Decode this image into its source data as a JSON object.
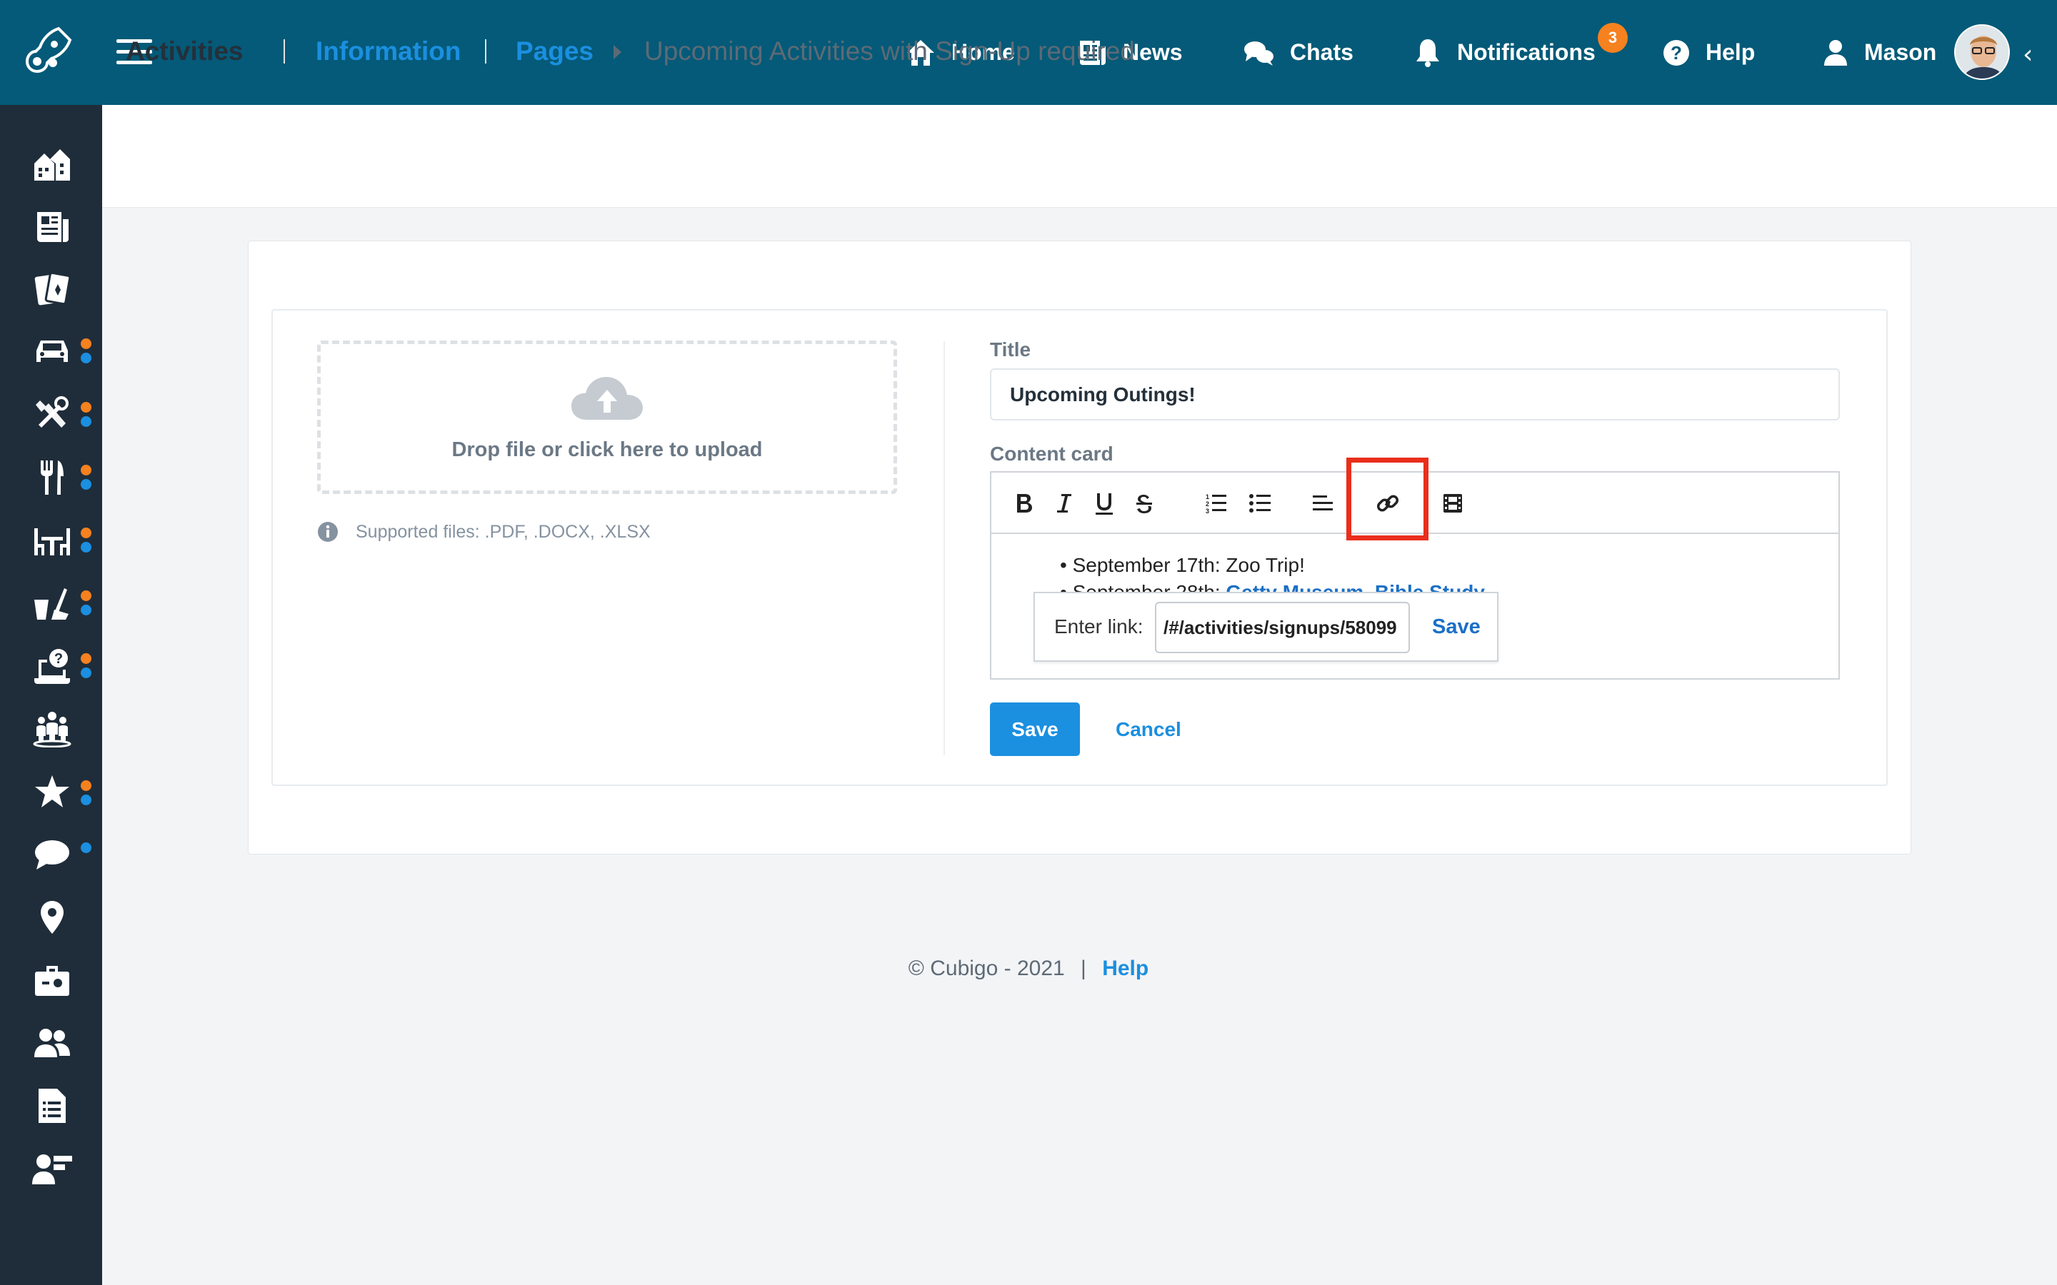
{
  "header": {
    "logo_icon": "rocket-logo-icon",
    "menu_icon": "hamburger-menu-icon",
    "nav": [
      {
        "label": "Home",
        "icon": "home-icon"
      },
      {
        "label": "News",
        "icon": "newspaper-icon"
      },
      {
        "label": "Chats",
        "icon": "chats-icon"
      },
      {
        "label": "Notifications",
        "icon": "bell-icon",
        "badge": "3"
      },
      {
        "label": "Help",
        "icon": "help-icon"
      },
      {
        "label": "Mason",
        "icon": "user-icon"
      }
    ],
    "collapse_glyph": "‹",
    "colors": {
      "bar": "#045a78",
      "badge": "#f5811f"
    }
  },
  "sidebar": {
    "items": [
      {
        "icon": "homes-icon",
        "dot": null
      },
      {
        "icon": "newspaper-icon",
        "dot": null
      },
      {
        "icon": "cards-icon",
        "dot": null
      },
      {
        "icon": "car-icon",
        "dot": "orange+blue"
      },
      {
        "icon": "tools-icon",
        "dot": "orange+blue"
      },
      {
        "icon": "dining-icon",
        "dot": "orange+blue"
      },
      {
        "icon": "table-chairs-icon",
        "dot": "orange+blue"
      },
      {
        "icon": "cleaning-icon",
        "dot": "orange+blue"
      },
      {
        "icon": "laptop-help-icon",
        "dot": "orange+blue"
      },
      {
        "icon": "community-icon",
        "dot": null
      },
      {
        "icon": "star-icon",
        "dot": "orange+blue"
      },
      {
        "icon": "chat-bubble-icon",
        "dot": "blue"
      },
      {
        "icon": "location-pin-icon",
        "dot": null
      },
      {
        "icon": "briefcase-icon",
        "dot": null
      },
      {
        "icon": "people-icon",
        "dot": null
      },
      {
        "icon": "document-list-icon",
        "dot": null
      },
      {
        "icon": "user-card-icon",
        "dot": null
      }
    ],
    "colors": {
      "bg": "#1f2d3a",
      "orange": "#f5811f",
      "blue": "#1b8fe0"
    }
  },
  "breadcrumb": {
    "root": "Activities",
    "links": [
      "Information",
      "Pages"
    ],
    "current": "Upcoming Activities with Sign-Up required"
  },
  "upload": {
    "dropzone_text": "Drop file or click here to upload",
    "supported_text": "Supported files: .PDF, .DOCX, .XLSX"
  },
  "form": {
    "title_label": "Title",
    "title_value": "Upcoming Outings!",
    "content_label": "Content card",
    "toolbar": [
      "bold",
      "italic",
      "underline",
      "strikethrough",
      "ordered-list",
      "bullet-list",
      "align",
      "link",
      "video"
    ],
    "content": {
      "line1": "September 17th: Zoo Trip!",
      "line2_prefix": "September 28th: ",
      "line2_link": "Getty Museum, Bible Study"
    },
    "link_popup": {
      "label": "Enter link:",
      "value": "/#/activities/signups/58099",
      "save_label": "Save"
    },
    "save_label": "Save",
    "cancel_label": "Cancel",
    "colors": {
      "primary": "#1b8fe0",
      "highlight": "#ea2e1b"
    }
  },
  "footer": {
    "copyright": "© Cubigo - 2021",
    "separator": "|",
    "help_label": "Help"
  }
}
